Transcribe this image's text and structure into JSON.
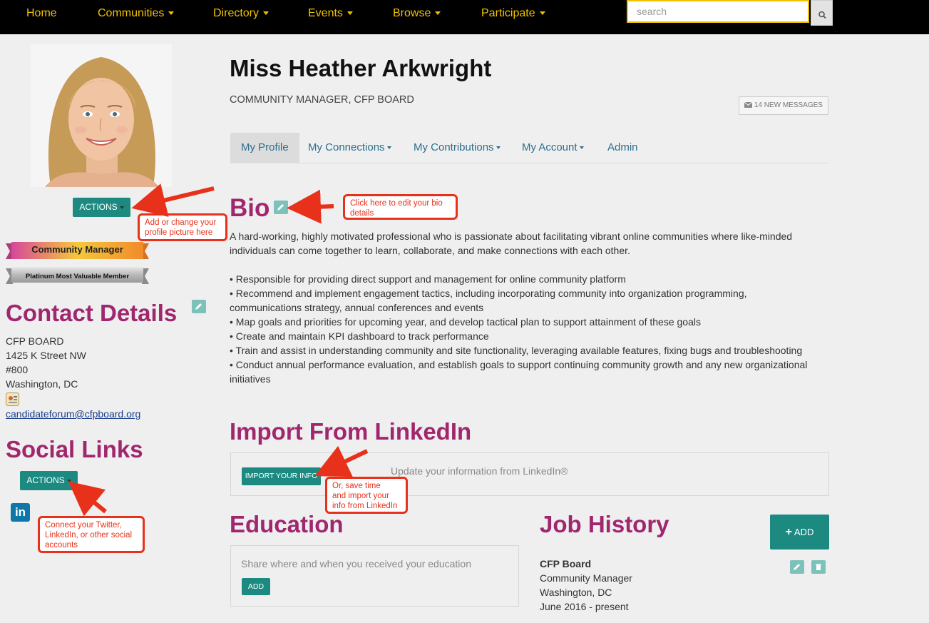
{
  "nav": {
    "items": [
      {
        "label": "Home",
        "dropdown": false
      },
      {
        "label": "Communities",
        "dropdown": true
      },
      {
        "label": "Directory",
        "dropdown": true
      },
      {
        "label": "Events",
        "dropdown": true
      },
      {
        "label": "Browse",
        "dropdown": true
      },
      {
        "label": "Participate",
        "dropdown": true
      }
    ],
    "search_placeholder": "search",
    "search_icon": "magnifier-icon"
  },
  "profile": {
    "name": "Miss Heather Arkwright",
    "title": "COMMUNITY MANAGER, CFP BOARD",
    "messages_label": "14 NEW MESSAGES",
    "actions_label": "ACTIONS"
  },
  "badges": {
    "community_manager": "Community Manager",
    "platinum": "Platinum Most Valuable Member"
  },
  "contact": {
    "heading": "Contact Details",
    "org": "CFP BOARD",
    "address1": "1425 K Street NW",
    "address2": "#800",
    "city": "Washington, DC",
    "email": "candidateforum@cfpboard.org"
  },
  "social": {
    "heading": "Social Links",
    "actions_label": "ACTIONS",
    "linkedin_icon": "in"
  },
  "tabs": [
    {
      "label": "My Profile",
      "dropdown": false,
      "active": true
    },
    {
      "label": "My Connections",
      "dropdown": true,
      "active": false
    },
    {
      "label": "My Contributions",
      "dropdown": true,
      "active": false
    },
    {
      "label": "My Account",
      "dropdown": true,
      "active": false
    },
    {
      "label": "Admin",
      "dropdown": false,
      "active": false
    }
  ],
  "bio": {
    "heading": "Bio",
    "intro_line1": "A hard-working, highly motivated professional who is passionate about facilitating vibrant online communities where like-minded",
    "intro_line2": "individuals can come together to learn, collaborate, and make connections with each other.",
    "bullets": [
      "• Responsible for providing direct support and management for online community platform",
      "• Recommend and implement engagement tactics, including incorporating community into organization programming,",
      "communications strategy, annual conferences and events",
      "• Map goals and priorities for upcoming year, and develop tactical plan to support attainment of these goals",
      "• Create and maintain KPI dashboard to track performance",
      "• Train and assist in understanding community and site functionality, leveraging available features, fixing bugs and troubleshooting",
      "• Conduct annual performance evaluation, and establish goals to support continuing community growth and any new organizational",
      "initiatives"
    ]
  },
  "linkedin": {
    "heading": "Import From LinkedIn",
    "button": "IMPORT YOUR INFO",
    "text": "Update your information from LinkedIn®"
  },
  "education": {
    "heading": "Education",
    "text": "Share where and when you received your education",
    "button": "ADD"
  },
  "jobs": {
    "heading": "Job History",
    "add_button": "ADD",
    "entry": {
      "company": "CFP Board",
      "role": "Community Manager",
      "location": "Washington, DC",
      "dates": "June 2016 - present"
    }
  },
  "callouts": {
    "picture": [
      "Add or change your",
      "profile picture here"
    ],
    "bio": [
      "Click here to edit your bio",
      "details"
    ],
    "linkedin": [
      "Or, save time",
      "and import your",
      "info from LinkedIn"
    ],
    "social": [
      "Connect your Twitter,",
      "LinkedIn, or other social",
      "accounts"
    ]
  },
  "colors": {
    "accent_teal": "#1d8a82",
    "heading_purple": "#a0266e",
    "nav_yellow": "#f2c200",
    "annotation_red": "#e8311a"
  }
}
